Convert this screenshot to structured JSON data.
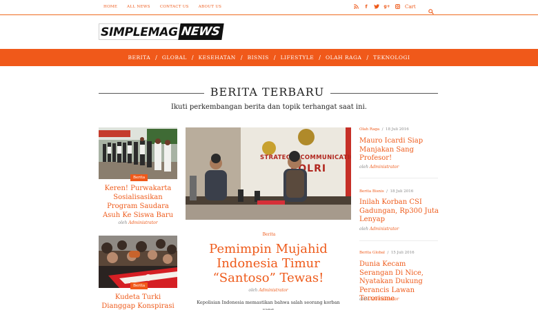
{
  "topbar": {
    "nav": [
      "HOME",
      "ALL NEWS",
      "CONTACT US",
      "ABOUT US"
    ],
    "social_icons": [
      "rss-icon",
      "facebook-icon",
      "twitter-icon",
      "google-plus-icon",
      "instagram-icon"
    ],
    "cart_label": "Cart"
  },
  "logo": {
    "part1": "SIMPLEMAG",
    "part2": "NEWS"
  },
  "main_nav": [
    "BERITA",
    "GLOBAL",
    "KESEHATAN",
    "BISNIS",
    "LIFESTYLE",
    "OLAH RAGA",
    "TEKNOLOGI"
  ],
  "section": {
    "title": "BERITA TERBARU",
    "subtitle": "Ikuti perkembangan berita dan topik terhangat saat ini."
  },
  "left_cards": [
    {
      "tag": "Berita",
      "title": "Keren! Purwakarta Sosialisasikan Program Saudara Asuh Ke Siswa Baru",
      "by_prefix": "oleh",
      "author": "Administrator"
    },
    {
      "tag": "Berita",
      "title": "Kudeta Turki Dianggap Konspirasi",
      "by_prefix": "oleh",
      "author": "Administrator"
    }
  ],
  "featured": {
    "banner_text": "STRATEGIC COMMUNICATIONS OF",
    "banner_text2": "POLRI",
    "tag": "Berita",
    "title": "Pemimpin Mujahid Indonesia Timur “Santoso” Tewas!",
    "by_prefix": "oleh",
    "author": "Administrator",
    "excerpt": "Kepolisian Indonesia memastikan bahwa salah seorang korban yang"
  },
  "right_list": [
    {
      "cat": "Olah Raga",
      "date": "18 Juli 2016",
      "title": "Mauro Icardi Siap Manjakan Sang Profesor!",
      "by_prefix": "oleh",
      "author": "Administrator"
    },
    {
      "cat": "Berita Bisnis",
      "date": "18 Juli 2016",
      "title": "Inilah Korban CSI Gadungan, Rp300 Juta Lenyap",
      "by_prefix": "oleh",
      "author": "Administrator"
    },
    {
      "cat": "Berita Global",
      "date": "15 Juli 2016",
      "title": "Dunia Kecam Serangan Di Nice, Nyatakan Dukung Perancis Lawan Terorisme",
      "by_prefix": "oleh",
      "author": "Administrator"
    }
  ],
  "colors": {
    "accent": "#f0591a",
    "text": "#222222",
    "muted": "#888888"
  }
}
